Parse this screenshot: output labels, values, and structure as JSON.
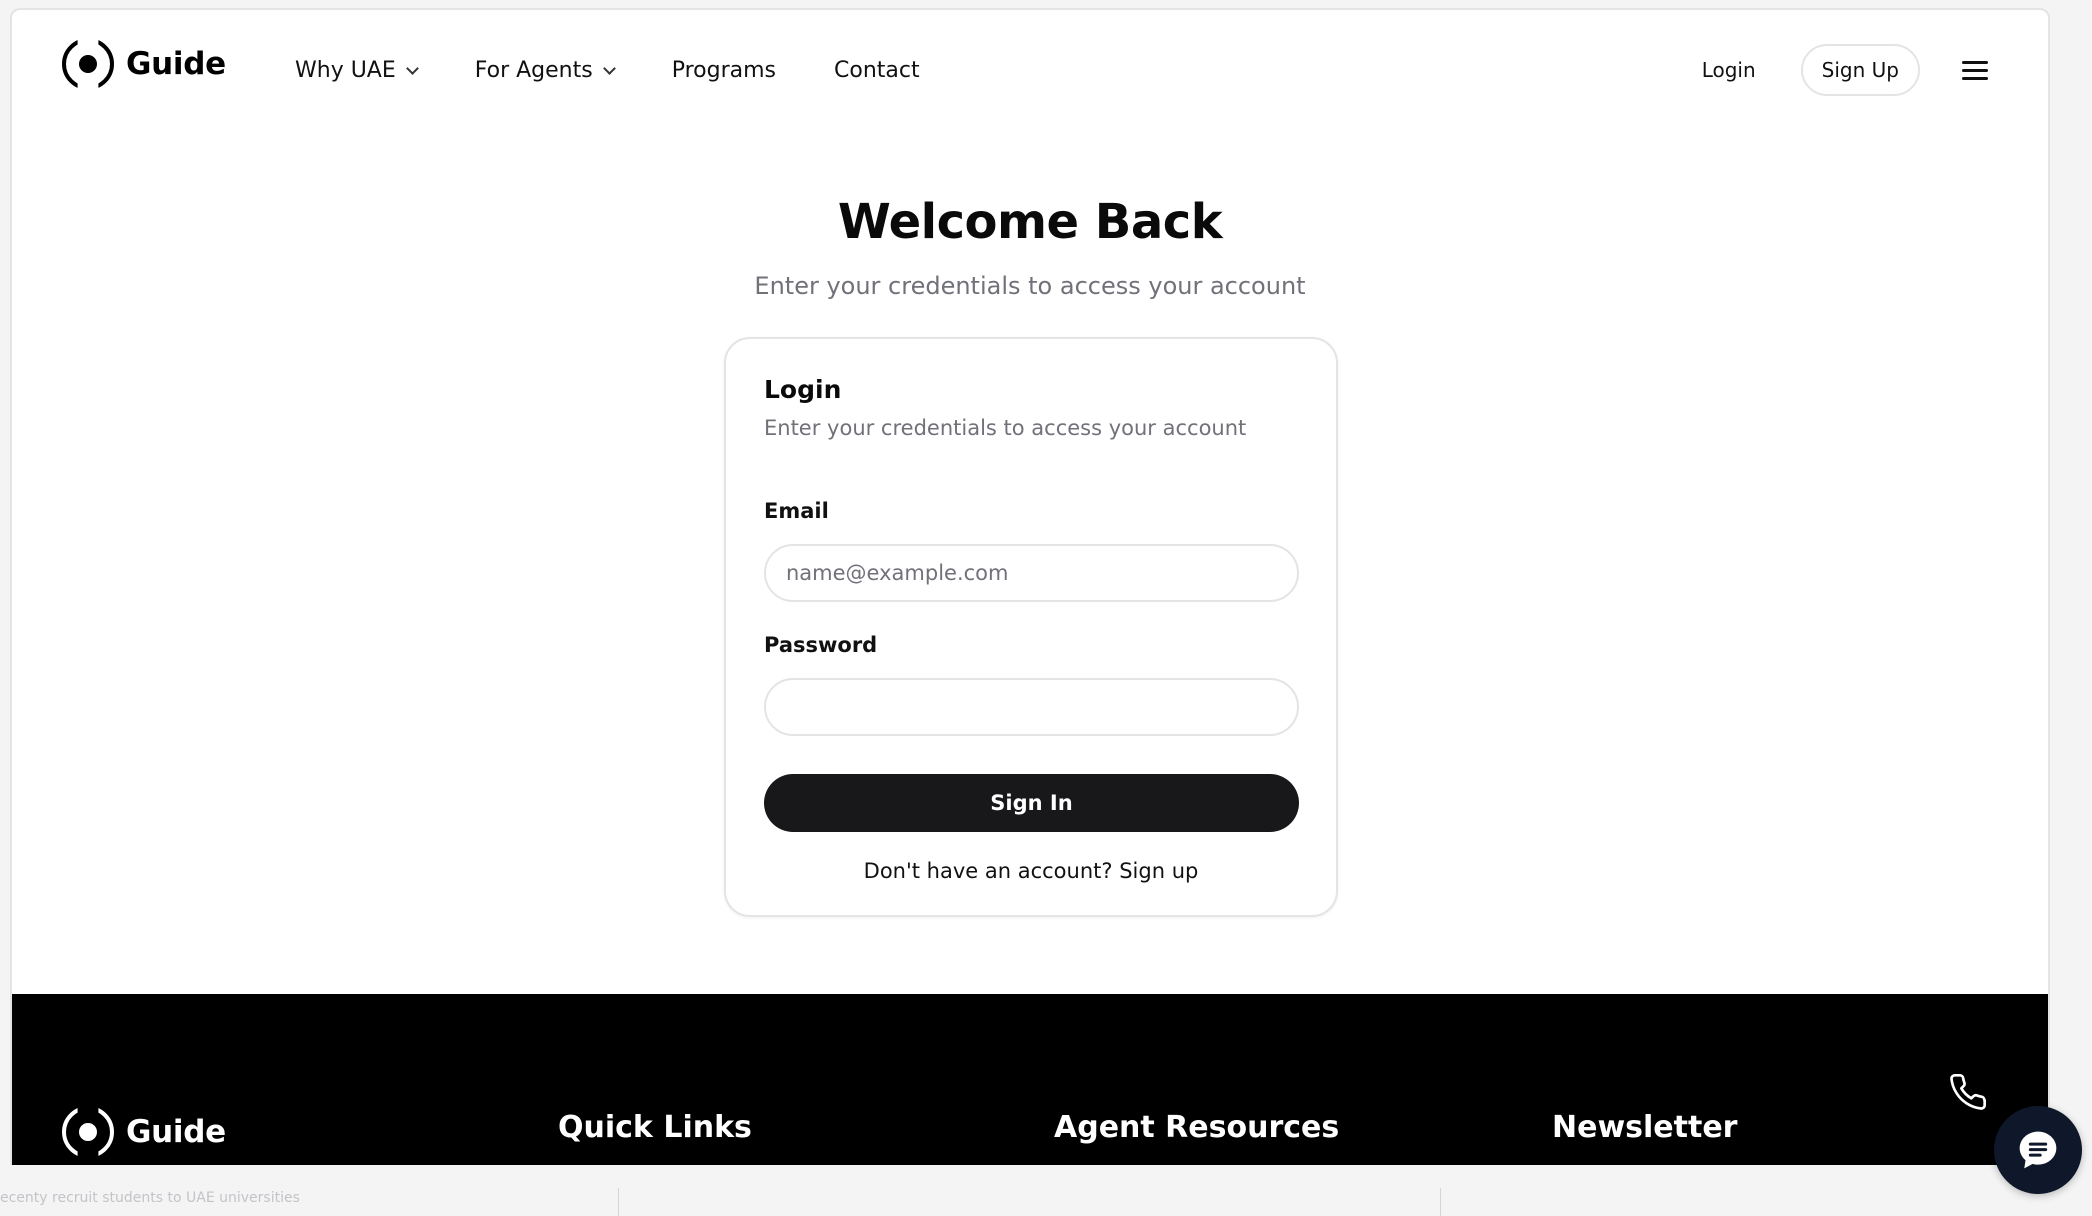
{
  "brand": {
    "name": "Guide"
  },
  "nav": {
    "links": [
      {
        "label": "Why UAE",
        "dropdown": true
      },
      {
        "label": "For Agents",
        "dropdown": true
      },
      {
        "label": "Programs",
        "dropdown": false
      },
      {
        "label": "Contact",
        "dropdown": false
      }
    ],
    "login_label": "Login",
    "signup_label": "Sign Up"
  },
  "hero": {
    "title": "Welcome Back",
    "subtitle": "Enter your credentials to access your account"
  },
  "card": {
    "title": "Login",
    "subtitle": "Enter your credentials to access your account",
    "email_label": "Email",
    "email_placeholder": "name@example.com",
    "email_value": "",
    "password_label": "Password",
    "password_value": "",
    "submit_label": "Sign In",
    "signup_prompt": "Don't have an account?",
    "signup_link": "Sign up"
  },
  "footer": {
    "brand": "Guide",
    "columns": [
      "Quick Links",
      "Agent Resources",
      "Newsletter"
    ]
  },
  "background_text": "ecenty recruit students to UAE universities",
  "colors": {
    "primary_button": "#18181b",
    "muted_text": "#71717a",
    "border": "#e4e4e7",
    "footer_bg": "#000000",
    "chat_bg": "#0f172a"
  },
  "icons": [
    "chevron-down-icon",
    "menu-icon",
    "phone-icon",
    "chat-icon"
  ]
}
